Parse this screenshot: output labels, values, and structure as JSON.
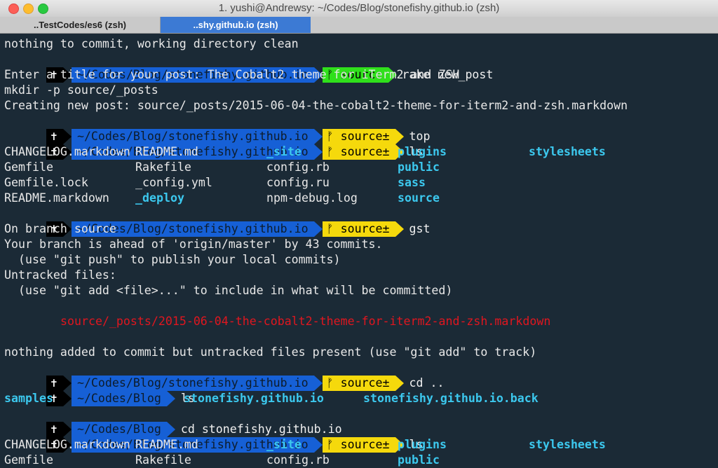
{
  "window": {
    "title": "1. yushi@Andrewsy: ~/Codes/Blog/stonefishy.github.io (zsh)",
    "tabs": [
      {
        "label": "..TestCodes/es6 (zsh)",
        "active": false
      },
      {
        "label": "..shy.github.io (zsh)",
        "active": true
      }
    ]
  },
  "colors": {
    "background": "#1b2a36",
    "prompt_dir": "#1660d6",
    "git_clean": "#2fe01b",
    "git_dirty": "#f5d90c",
    "directory": "#3cc8ee",
    "untracked": "#e0161f"
  },
  "prompt": {
    "cross": "✝",
    "dir_full": "~/Codes/Blog/stonefishy.github.io",
    "dir_parent": "~/Codes/Blog",
    "git_clean": "ᚠ source",
    "git_dirty": "ᚠ source±"
  },
  "terminal": {
    "l1": "nothing to commit, working directory clean",
    "p1_cmd": "rake new_post",
    "l3": "Enter a title for your post: The Cobalt2 theme for iTerm2 and ZSH",
    "l4": "mkdir -p source/_posts",
    "l5": "Creating new post: source/_posts/2015-06-04-the-cobalt2-theme-for-iterm2-and-zsh.markdown",
    "p2_cmd": "top",
    "p3_cmd": "ls",
    "ls1": [
      [
        "CHANGELOG.markdown",
        "README.md",
        "_site",
        "plugins",
        "stylesheets"
      ],
      [
        "Gemfile",
        "Rakefile",
        "config.rb",
        "public"
      ],
      [
        "Gemfile.lock",
        "_config.yml",
        "config.ru",
        "sass"
      ],
      [
        "README.markdown",
        "_deploy",
        "npm-debug.log",
        "source"
      ]
    ],
    "p4_cmd": "gst",
    "g1": "On branch source",
    "g2": "Your branch is ahead of 'origin/master' by 43 commits.",
    "g3": "  (use \"git push\" to publish your local commits)",
    "g4": "Untracked files:",
    "g5": "  (use \"git add <file>...\" to include in what will be committed)",
    "g6": "source/_posts/2015-06-04-the-cobalt2-theme-for-iterm2-and-zsh.markdown",
    "g7": "nothing added to commit but untracked files present (use \"git add\" to track)",
    "p5_cmd": "cd ..",
    "p6_cmd": "ls",
    "ls2": [
      "samples",
      "stonefishy.github.io",
      "stonefishy.github.io.back"
    ],
    "p7_cmd": "cd stonefishy.github.io",
    "p8_cmd": "ls",
    "ls3": [
      [
        "CHANGELOG.markdown",
        "README.md",
        "_site",
        "plugins",
        "stylesheets"
      ],
      [
        "Gemfile",
        "Rakefile",
        "config.rb",
        "public"
      ]
    ]
  }
}
